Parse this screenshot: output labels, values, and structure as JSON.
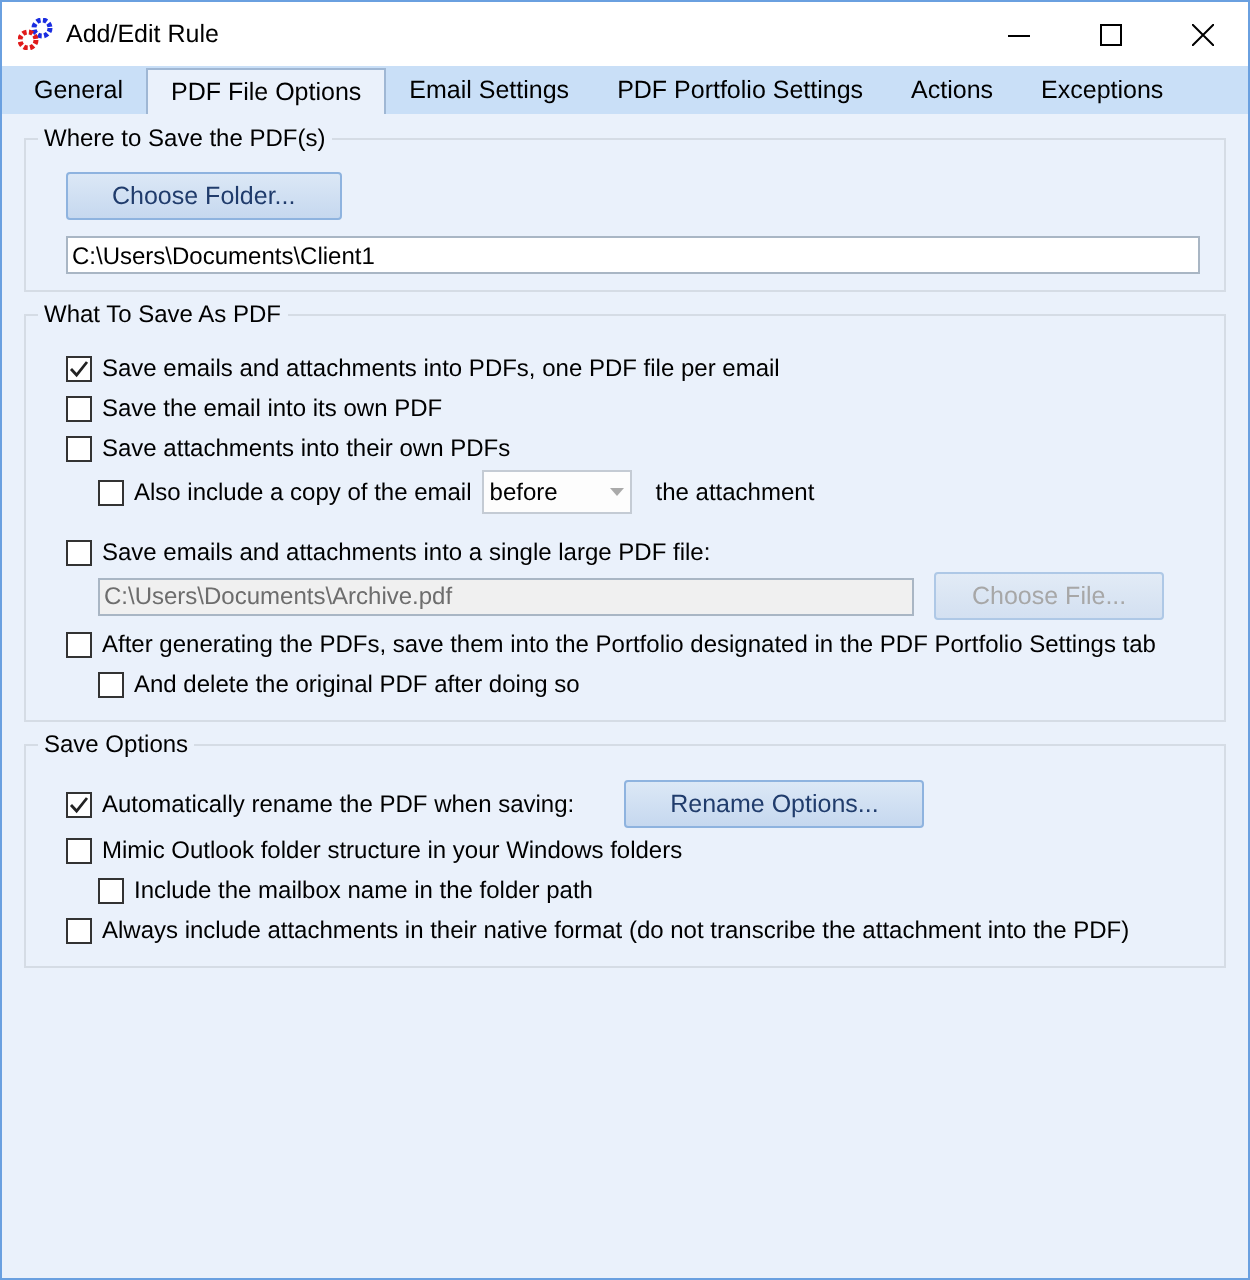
{
  "window": {
    "title": "Add/Edit Rule"
  },
  "tabs": [
    {
      "label": "General",
      "selected": false
    },
    {
      "label": "PDF File Options",
      "selected": true
    },
    {
      "label": "Email Settings",
      "selected": false
    },
    {
      "label": "PDF Portfolio Settings",
      "selected": false
    },
    {
      "label": "Actions",
      "selected": false
    },
    {
      "label": "Exceptions",
      "selected": false
    }
  ],
  "groups": [
    {
      "title": "Where to Save the PDF(s)",
      "items": [
        {
          "kind": "button",
          "label": "Choose Folder...",
          "disabled": false
        },
        {
          "kind": "field",
          "value": "C:\\Users\\Documents\\Client1",
          "disabled": false
        }
      ]
    },
    {
      "title": "What To Save As PDF",
      "items": [
        {
          "kind": "checkbox",
          "label": "Save emails and attachments into PDFs, one PDF file per email",
          "checked": true
        },
        {
          "kind": "checkbox",
          "label": "Save the email into its own PDF",
          "checked": false
        },
        {
          "kind": "checkbox",
          "label": "Save attachments into their own PDFs",
          "checked": false,
          "children": [
            {
              "kind": "checkbox-select",
              "label": "Also include a copy of the email",
              "checked": false,
              "select_value": "before",
              "suffix": "the attachment"
            }
          ]
        },
        {
          "kind": "checkbox",
          "label": "Save emails and attachments into a single large PDF file:",
          "checked": false,
          "children": [
            {
              "kind": "file-row",
              "value": "C:\\Users\\Documents\\Archive.pdf",
              "button": "Choose File...",
              "disabled": true
            }
          ]
        },
        {
          "kind": "checkbox",
          "label": "After generating the PDFs, save them into the Portfolio designated in the PDF Portfolio Settings tab",
          "checked": false,
          "children": [
            {
              "kind": "checkbox",
              "label": "And delete the original PDF after doing so",
              "checked": false
            }
          ]
        }
      ]
    },
    {
      "title": "Save Options",
      "items": [
        {
          "kind": "checkbox-button",
          "label": "Automatically rename the PDF when saving:",
          "checked": true,
          "button": "Rename Options..."
        },
        {
          "kind": "checkbox",
          "label": "Mimic Outlook folder structure in your Windows folders",
          "checked": false,
          "children": [
            {
              "kind": "checkbox",
              "label": "Include the mailbox name in the folder path",
              "checked": false
            }
          ]
        },
        {
          "kind": "checkbox",
          "label": "Always include attachments in their native format (do not transcribe the attachment into the PDF)",
          "checked": false
        }
      ]
    }
  ]
}
